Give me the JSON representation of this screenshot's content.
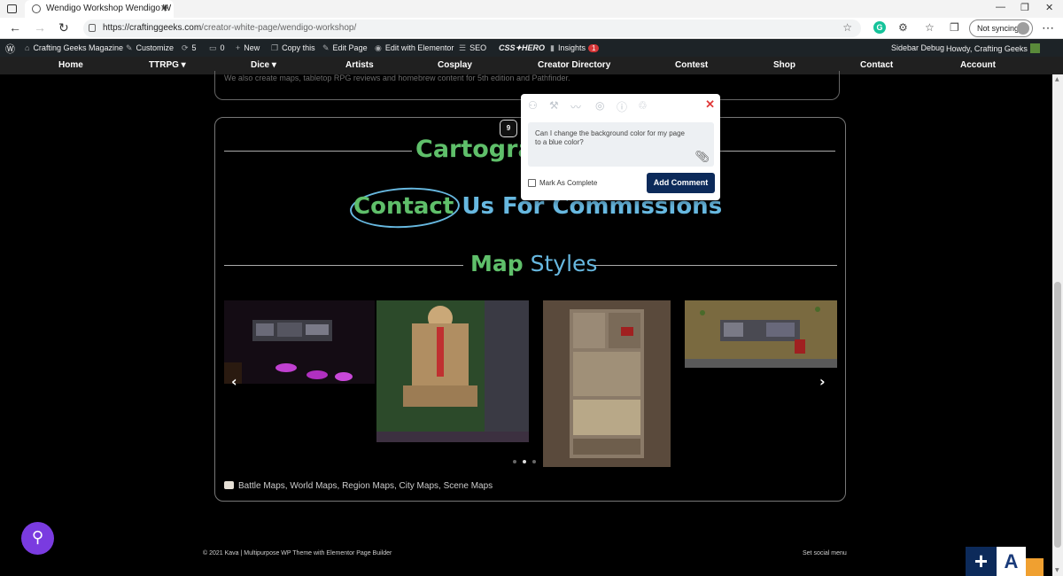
{
  "browser": {
    "tab_title": "Wendigo Workshop Wendigo W",
    "tab_close": "✕",
    "new_tab": "+",
    "url_host": "https://craftinggeeks.com",
    "url_path": "/creator-white-page/wendigo-workshop/",
    "sync_label": "Not syncing",
    "window_controls": [
      "—",
      "❐",
      "✕"
    ]
  },
  "adminbar": {
    "site_name": "Crafting Geeks Magazine",
    "customize": "Customize",
    "updates_count": "5",
    "comments_count": "0",
    "new": "New",
    "copy_this": "Copy this",
    "edit_page": "Edit Page",
    "edit_elementor": "Edit with Elementor",
    "seo": "SEO",
    "css_hero": "CSS✦HERO",
    "insights": "Insights",
    "insights_badge": "1",
    "sidebar_debug": "Sidebar Debug",
    "howdy": "Howdy, Crafting Geeks"
  },
  "menu": {
    "items": [
      "Home",
      "TTRPG ▾",
      "Dice ▾",
      "Artists",
      "Cosplay",
      "Creator Directory",
      "Contest",
      "Shop",
      "Contact",
      "Account"
    ]
  },
  "content": {
    "prev_text": "We also create maps, tabletop RPG reviews and homebrew content for 5th edition and Pathfinder.",
    "badge_number": "9",
    "cartography_heading": "Cartograp",
    "contact_word": "Contact",
    "contact_rest": " Us For Commissions",
    "map_word": "Map",
    "styles_word": " Styles",
    "arrow_left": "‹",
    "arrow_right": "›",
    "map_styles_list": "Battle Maps, World Maps, Region Maps, City Maps, Scene Maps",
    "carousel_active_index": 1
  },
  "comment_popup": {
    "close": "✕",
    "comment_text": "Can I change the background color for my page to a blue color?",
    "mark_complete_label": "Mark As Complete",
    "add_comment_label": "Add Comment"
  },
  "footer": {
    "copyright": "© 2021 Kava | Multipurpose WP Theme with Elementor Page Builder",
    "social": "Set social menu"
  },
  "floating": {
    "plus": "+",
    "a": "A"
  },
  "icons": {
    "wp": "wordpress-logo-icon",
    "fab": "search-wand-icon"
  }
}
